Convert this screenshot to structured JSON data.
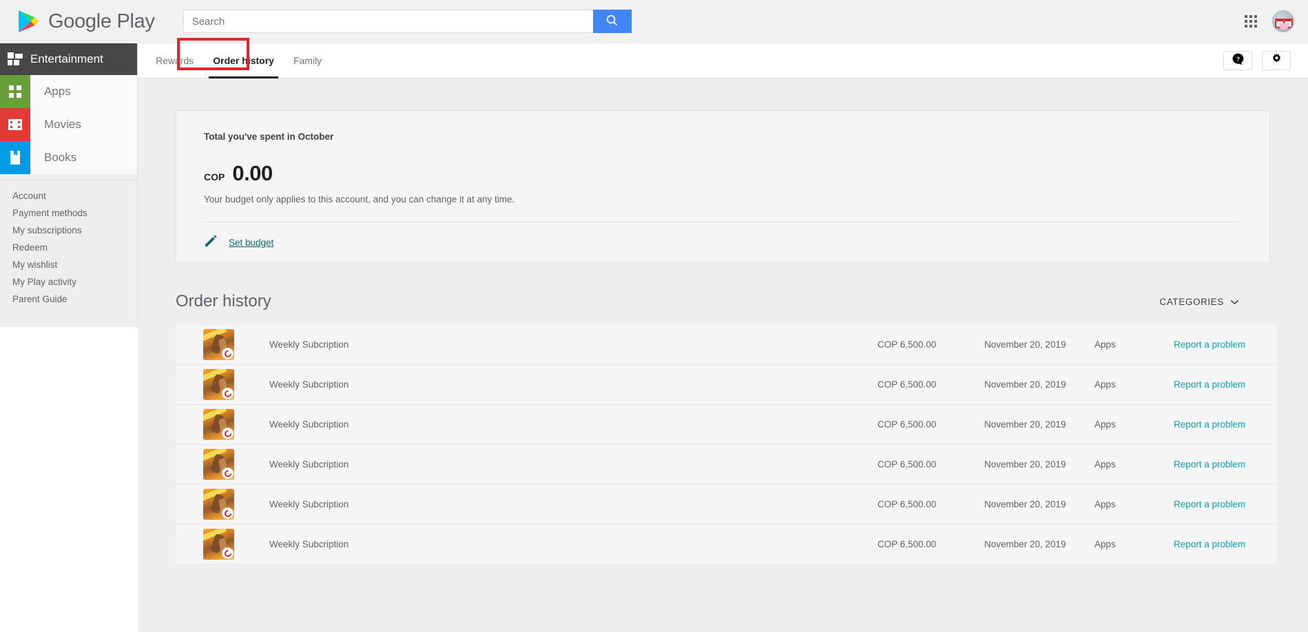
{
  "topbar": {
    "brand_name": "Google Play",
    "search_placeholder": "Search",
    "search_value": "",
    "search_icon": "search-icon",
    "apps_grid_icon": "apps-grid-icon",
    "avatar_icon": "account-avatar"
  },
  "sidebar": {
    "header": {
      "label": "Entertainment",
      "icon": "entertainment-tiles-icon"
    },
    "categories": [
      {
        "label": "Apps",
        "icon": "apps-icon",
        "color": "#689f38"
      },
      {
        "label": "Movies",
        "icon": "movies-icon",
        "color": "#e53935"
      },
      {
        "label": "Books",
        "icon": "books-icon",
        "color": "#039be5"
      }
    ],
    "links": [
      "Account",
      "Payment methods",
      "My subscriptions",
      "Redeem",
      "My wishlist",
      "My Play activity",
      "Parent Guide"
    ]
  },
  "tabs": [
    {
      "label": "Rewards",
      "active": false
    },
    {
      "label": "Order history",
      "active": true
    },
    {
      "label": "Family",
      "active": false
    }
  ],
  "header_actions": [
    {
      "name": "help-button",
      "icon": "help-icon"
    },
    {
      "name": "settings-button",
      "icon": "gear-icon"
    }
  ],
  "budget_card": {
    "title": "Total you've spent in October",
    "currency": "COP",
    "amount": "0.00",
    "note": "Your budget only applies to this account, and you can change it at any time.",
    "action_label": "Set budget",
    "action_icon": "pencil-icon"
  },
  "order_section": {
    "title": "Order history",
    "categories_label": "CATEGORIES",
    "categories_icon": "chevron-down-icon",
    "rows": [
      {
        "title": "Weekly Subcription",
        "price": "COP 6,500.00",
        "date": "November 20, 2019",
        "category": "Apps",
        "action": "Report a problem"
      },
      {
        "title": "Weekly Subcription",
        "price": "COP 6,500.00",
        "date": "November 20, 2019",
        "category": "Apps",
        "action": "Report a problem"
      },
      {
        "title": "Weekly Subcription",
        "price": "COP 6,500.00",
        "date": "November 20, 2019",
        "category": "Apps",
        "action": "Report a problem"
      },
      {
        "title": "Weekly Subcription",
        "price": "COP 6,500.00",
        "date": "November 20, 2019",
        "category": "Apps",
        "action": "Report a problem"
      },
      {
        "title": "Weekly Subcription",
        "price": "COP 6,500.00",
        "date": "November 20, 2019",
        "category": "Apps",
        "action": "Report a problem"
      },
      {
        "title": "Weekly Subcription",
        "price": "COP 6,500.00",
        "date": "November 20, 2019",
        "category": "Apps",
        "action": "Report a problem"
      }
    ]
  },
  "colors": {
    "accent_blue": "#4285f4",
    "link_teal": "#10a0b4",
    "budget_link": "#10656d",
    "annotation_red": "#e8212a",
    "sidebar_header": "#464646"
  }
}
